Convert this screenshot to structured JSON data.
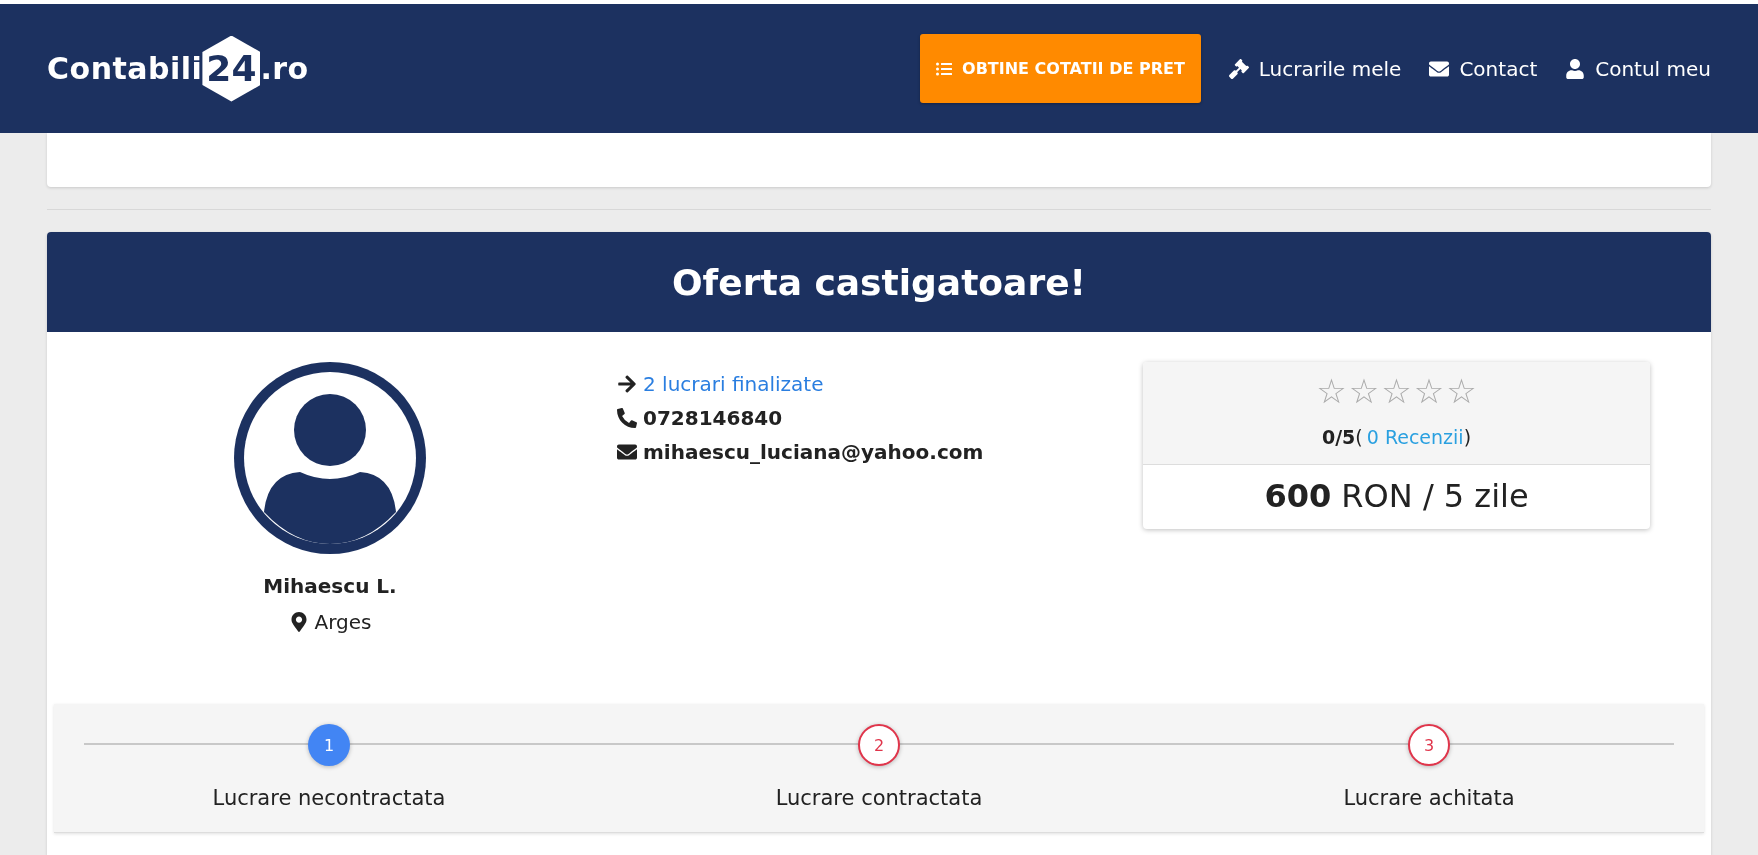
{
  "logo": {
    "name": "Contabili",
    "badge": "24",
    "suffix": ".ro"
  },
  "nav": {
    "cta": "OBTINE COTATII DE PRET",
    "links": [
      {
        "kind": "gavel",
        "label": "Lucrarile mele"
      },
      {
        "kind": "mail",
        "label": "Contact"
      },
      {
        "kind": "user",
        "label": "Contul meu"
      }
    ]
  },
  "offer": {
    "title": "Oferta castigatoare!",
    "provider": {
      "name": "Mihaescu L.",
      "location": "Arges"
    },
    "details": [
      {
        "kind": "arrow",
        "text": "2 lucrari finalizate"
      },
      {
        "kind": "phone",
        "text": "0728146840"
      },
      {
        "kind": "mail",
        "text": "mihaescu_luciana@yahoo.com"
      }
    ],
    "rating": {
      "stars": 0,
      "score": "0/5",
      "open": "(",
      "reviews": "0 Recenzii",
      "close": ")"
    },
    "price": "**600** RON / 5 zile"
  },
  "steps": [
    {
      "number": "1",
      "label": "Lucrare necontractata",
      "selected": true
    },
    {
      "number": "2",
      "label": "Lucrare contractata",
      "selected": false
    },
    {
      "number": "3",
      "label": "Lucrare achitata",
      "selected": false
    }
  ]
}
